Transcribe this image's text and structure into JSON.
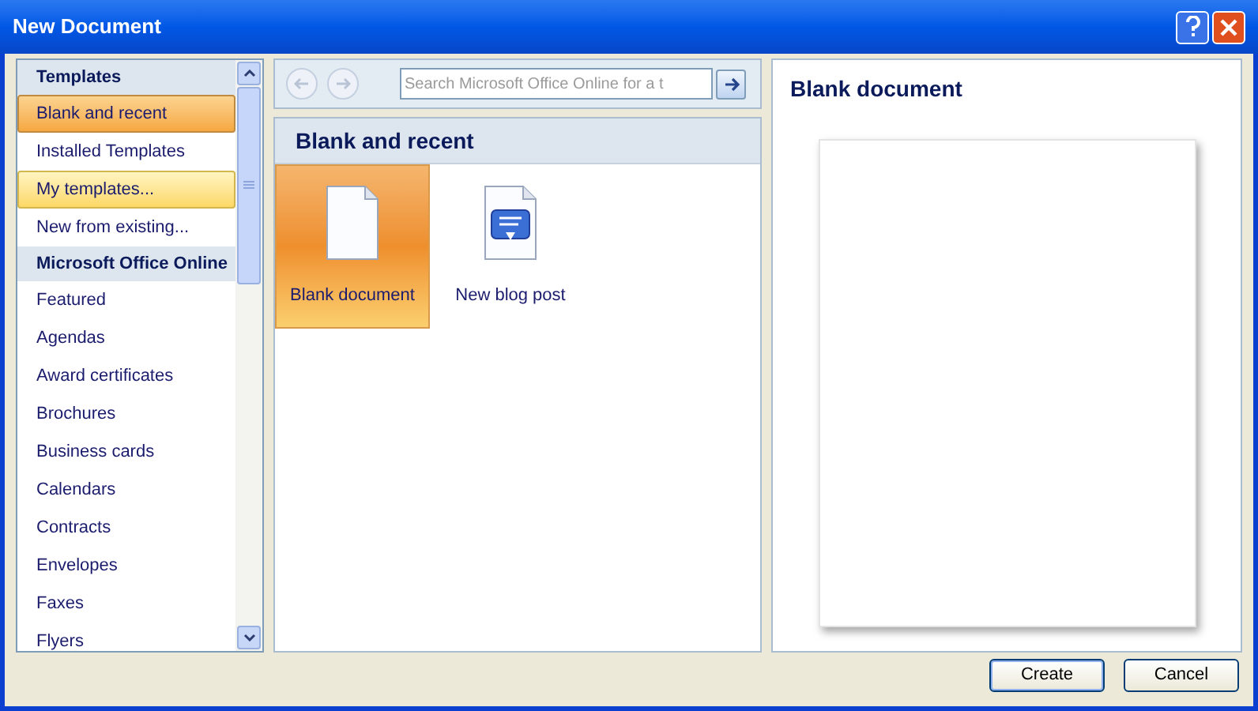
{
  "window": {
    "title": "New Document"
  },
  "sidebar": {
    "items": [
      {
        "kind": "header",
        "label": "Templates"
      },
      {
        "kind": "item",
        "label": "Blank and recent",
        "selected": true,
        "hovered": false
      },
      {
        "kind": "item",
        "label": "Installed Templates",
        "selected": false,
        "hovered": false
      },
      {
        "kind": "item",
        "label": "My templates...",
        "selected": false,
        "hovered": true
      },
      {
        "kind": "item",
        "label": "New from existing...",
        "selected": false,
        "hovered": false
      },
      {
        "kind": "header",
        "label": "Microsoft Office Online"
      },
      {
        "kind": "item",
        "label": "Featured",
        "selected": false,
        "hovered": false
      },
      {
        "kind": "item",
        "label": "Agendas",
        "selected": false,
        "hovered": false
      },
      {
        "kind": "item",
        "label": "Award certificates",
        "selected": false,
        "hovered": false
      },
      {
        "kind": "item",
        "label": "Brochures",
        "selected": false,
        "hovered": false
      },
      {
        "kind": "item",
        "label": "Business cards",
        "selected": false,
        "hovered": false
      },
      {
        "kind": "item",
        "label": "Calendars",
        "selected": false,
        "hovered": false
      },
      {
        "kind": "item",
        "label": "Contracts",
        "selected": false,
        "hovered": false
      },
      {
        "kind": "item",
        "label": "Envelopes",
        "selected": false,
        "hovered": false
      },
      {
        "kind": "item",
        "label": "Faxes",
        "selected": false,
        "hovered": false
      },
      {
        "kind": "item",
        "label": "Flyers",
        "selected": false,
        "hovered": false
      }
    ]
  },
  "search": {
    "placeholder": "Search Microsoft Office Online for a t"
  },
  "gallery": {
    "title": "Blank and recent",
    "templates": [
      {
        "kind": "blank",
        "label": "Blank document",
        "selected": true
      },
      {
        "kind": "blog",
        "label": "New blog post",
        "selected": false
      }
    ]
  },
  "preview": {
    "title": "Blank document"
  },
  "buttons": [
    {
      "label": "Create",
      "default": true
    },
    {
      "label": "Cancel",
      "default": false
    }
  ]
}
